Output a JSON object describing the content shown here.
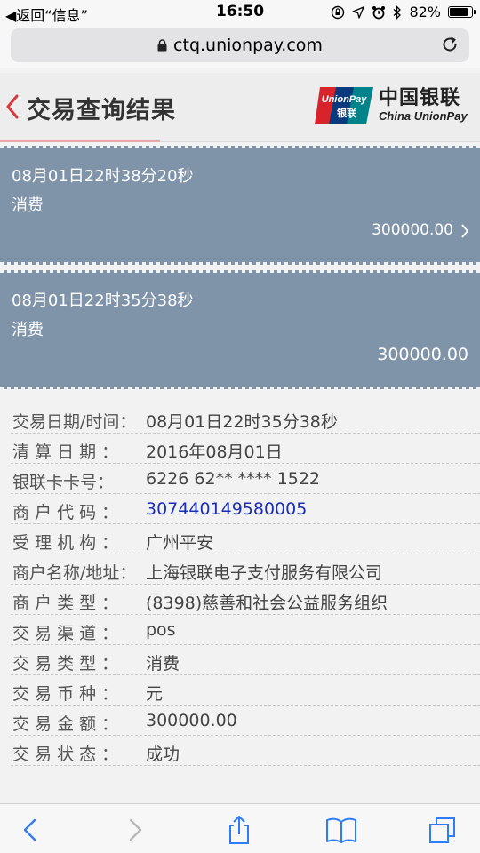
{
  "status_bar": {
    "back_label": "◀返回“信息”",
    "time": "16:50",
    "battery": "82%",
    "battery_level": 0.82
  },
  "browser": {
    "url": "ctq.unionpay.com"
  },
  "header": {
    "title": "交易查询结果",
    "logo_badge_line1": "UnionPay",
    "logo_badge_line2": "银联",
    "logo_cn": "中国银联",
    "logo_en": "China UnionPay"
  },
  "transactions": [
    {
      "datetime": "08月01日22时38分20秒",
      "type": "消费",
      "amount": "300000.00"
    },
    {
      "datetime": "08月01日22时35分38秒",
      "type": "消费",
      "amount": "300000.00"
    }
  ],
  "details": [
    {
      "label": "交易日期/时间：",
      "value": "08月01日22时35分38秒"
    },
    {
      "label": "清 算 日 期 ：",
      "value": "2016年08月01日"
    },
    {
      "label": "银联卡卡号：",
      "value": "6226 62** **** 1522"
    },
    {
      "label": "商 户 代 码 ：",
      "value": "307440149580005"
    },
    {
      "label": "受 理 机 构 ：",
      "value": "广州平安"
    },
    {
      "label": "商户名称/地址：",
      "value": "上海银联电子支付服务有限公司"
    },
    {
      "label": "商 户 类 型 ：",
      "value": "(8398)慈善和社会公益服务组织"
    },
    {
      "label": "交 易 渠 道 ：",
      "value": "pos"
    },
    {
      "label": "交 易 类 型 ：",
      "value": "消费"
    },
    {
      "label": "交 易 币 种 ：",
      "value": "元"
    },
    {
      "label": "交 易 金 额 ：",
      "value": "300000.00"
    },
    {
      "label": "交 易 状 态 ：",
      "value": "成功"
    }
  ],
  "colors": {
    "card_bg": "#7f93a9",
    "link": "#1a2fb5",
    "accent_red": "#d9363e",
    "ios_blue": "#2f7df6"
  }
}
